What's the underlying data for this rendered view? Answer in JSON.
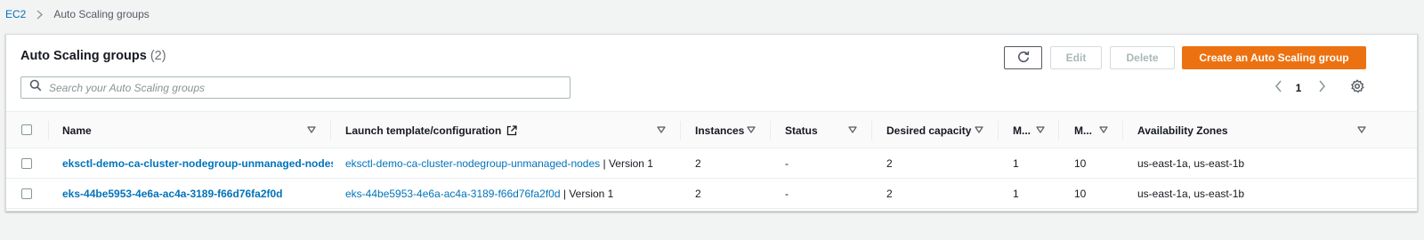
{
  "breadcrumb": {
    "root": "EC2",
    "current": "Auto Scaling groups"
  },
  "panel": {
    "title": "Auto Scaling groups",
    "count": "(2)"
  },
  "actions": {
    "edit": "Edit",
    "delete": "Delete",
    "create": "Create an Auto Scaling group"
  },
  "search": {
    "placeholder": "Search your Auto Scaling groups"
  },
  "pagination": {
    "current_page": "1"
  },
  "table": {
    "columns": [
      "Name",
      "Launch template/configuration",
      "Instances",
      "Status",
      "Desired capacity",
      "M...",
      "M...",
      "Availability Zones"
    ],
    "rows": [
      {
        "name": "eksctl-demo-ca-cluster-nodegroup-unmanaged-nodes",
        "template_link": "eksctl-demo-ca-cluster-nodegroup-unmanaged-nodes",
        "template_version": " | Version 1",
        "instances": "2",
        "status": "-",
        "desired": "2",
        "min": "1",
        "max": "10",
        "zones": "us-east-1a, us-east-1b"
      },
      {
        "name": "eks-44be5953-4e6a-ac4a-3189-f66d76fa2f0d",
        "template_link": "eks-44be5953-4e6a-ac4a-3189-f66d76fa2f0d",
        "template_version": " | Version 1",
        "instances": "2",
        "status": "-",
        "desired": "2",
        "min": "1",
        "max": "10",
        "zones": "us-east-1a, us-east-1b"
      }
    ]
  },
  "colors": {
    "link": "#0073bb",
    "primary_button": "#ec7211",
    "background": "#f2f3f3"
  },
  "icons": {
    "refresh": "refresh-icon",
    "search": "search-icon",
    "external_link": "external-link-icon",
    "sort": "caret-down-icon",
    "settings": "gear-icon"
  }
}
